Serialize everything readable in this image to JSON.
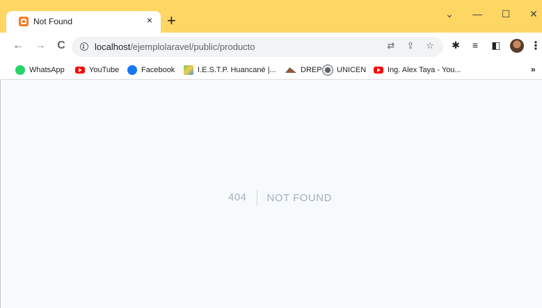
{
  "browser": {
    "tab": {
      "title": "Not Found",
      "close": "×"
    },
    "new_tab": "+",
    "window_controls": {
      "minimize": "—",
      "maximize": "☐",
      "close": "✕",
      "dropdown": "⌄"
    },
    "nav": {
      "back": "←",
      "forward": "→",
      "reload": "C"
    },
    "address": {
      "host": "localhost",
      "path": "/ejemplolaravel/public/producto"
    },
    "toolbar_icons": [
      "translate-icon",
      "share-icon",
      "star-icon",
      "extensions-icon",
      "media-icon",
      "sidepanel-icon",
      "profile-avatar",
      "menu-icon"
    ],
    "menu": "⋮"
  },
  "bookmarks": [
    {
      "label": "WhatsApp",
      "icon": "whatsapp-icon"
    },
    {
      "label": "YouTube",
      "icon": "youtube-icon"
    },
    {
      "label": "Facebook",
      "icon": "facebook-icon"
    },
    {
      "label": "I.E.S.T.P. Huancané |...",
      "icon": "iestp-icon"
    },
    {
      "label": "DREP",
      "icon": "drep-icon"
    },
    {
      "label": "UNICEN",
      "icon": "unicen-icon"
    },
    {
      "label": "Ing. Alex Taya - You...",
      "icon": "youtube-icon"
    }
  ],
  "bookmarks_more": "»",
  "page": {
    "code": "404",
    "message": "NOT FOUND"
  },
  "colors": {
    "chrome_accent": "#fdd663",
    "page_bg": "#f7fafc",
    "error_text": "#a0aec0"
  }
}
